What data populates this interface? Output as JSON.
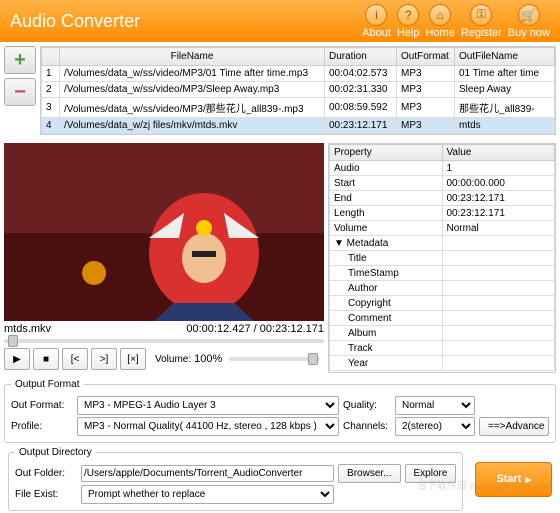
{
  "header": {
    "title": "Audio Converter",
    "buttons": [
      {
        "label": "About",
        "icon": "i"
      },
      {
        "label": "Help",
        "icon": "?"
      },
      {
        "label": "Home",
        "icon": "⌂"
      },
      {
        "label": "Register",
        "icon": "⚿"
      },
      {
        "label": "Buy now",
        "icon": "🛒"
      }
    ]
  },
  "filetable": {
    "headers": [
      "",
      "FileName",
      "Duration",
      "OutFormat",
      "OutFileName"
    ],
    "rows": [
      {
        "n": "1",
        "file": "/Volumes/data_w/ss/video/MP3/01 Time after time.mp3",
        "dur": "00:04:02.573",
        "fmt": "MP3",
        "out": "01 Time after time"
      },
      {
        "n": "2",
        "file": "/Volumes/data_w/ss/video/MP3/Sleep Away.mp3",
        "dur": "00:02:31.330",
        "fmt": "MP3",
        "out": "Sleep Away"
      },
      {
        "n": "3",
        "file": "/Volumes/data_w/ss/video/MP3/那些花儿_all839-.mp3",
        "dur": "00:08:59.592",
        "fmt": "MP3",
        "out": "那些花儿_all839-"
      },
      {
        "n": "4",
        "file": "/Volumes/data_w/zj files/mkv/mtds.mkv",
        "dur": "00:23:12.171",
        "fmt": "MP3",
        "out": "mtds"
      }
    ]
  },
  "preview": {
    "filename": "mtds.mkv",
    "time": "00:00:12.427 / 00:23:12.171",
    "volume_label": "Volume:",
    "volume_value": "100%"
  },
  "properties": {
    "headers": [
      "Property",
      "Value"
    ],
    "rows": [
      {
        "k": "Audio",
        "v": "1"
      },
      {
        "k": "Start",
        "v": "00:00:00.000"
      },
      {
        "k": "End",
        "v": "00:23:12.171"
      },
      {
        "k": "Length",
        "v": "00:23:12.171"
      },
      {
        "k": "Volume",
        "v": "Normal"
      },
      {
        "k": "Metadata",
        "v": "",
        "hdr": true
      },
      {
        "k": "Title",
        "v": "",
        "ind": true
      },
      {
        "k": "TimeStamp",
        "v": "",
        "ind": true
      },
      {
        "k": "Author",
        "v": "",
        "ind": true
      },
      {
        "k": "Copyright",
        "v": "",
        "ind": true
      },
      {
        "k": "Comment",
        "v": "",
        "ind": true
      },
      {
        "k": "Album",
        "v": "",
        "ind": true
      },
      {
        "k": "Track",
        "v": "",
        "ind": true
      },
      {
        "k": "Year",
        "v": "",
        "ind": true
      }
    ]
  },
  "output_format": {
    "legend": "Output Format",
    "out_format_label": "Out Format:",
    "out_format_value": "MP3 - MPEG-1 Audio Layer 3",
    "profile_label": "Profile:",
    "profile_value": "MP3 - Normal Quality( 44100 Hz, stereo , 128 kbps )",
    "quality_label": "Quality:",
    "quality_value": "Normal",
    "channels_label": "Channels:",
    "channels_value": "2(stereo)",
    "advance_label": "==>Advance"
  },
  "output_dir": {
    "legend": "Output Directory",
    "folder_label": "Out Folder:",
    "folder_value": "/Users/apple/Documents/Torrent_AudioConverter",
    "browser_label": "Browser...",
    "explore_label": "Explore",
    "exist_label": "File Exist:",
    "exist_value": "Prompt whether to replace"
  },
  "start_label": "Start",
  "watermark": "当下软件园 www.downxia.com"
}
